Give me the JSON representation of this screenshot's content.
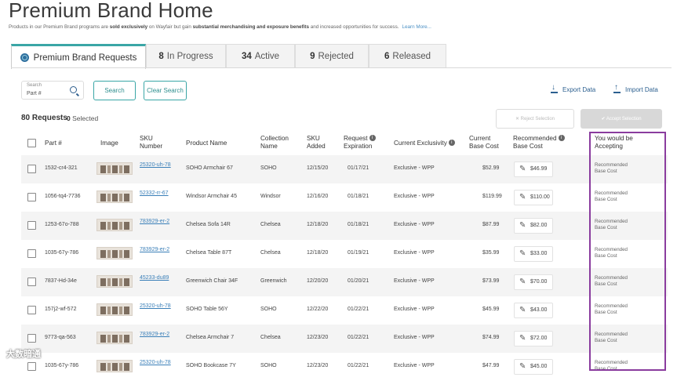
{
  "header": {
    "title": "Premium Brand Home",
    "subtitle_pre": "Products in our Premium Brand programs are ",
    "subtitle_b1": "sold exclusively",
    "subtitle_mid": " on Wayfair but gain ",
    "subtitle_b2": "substantial merchandising and exposure benefits",
    "subtitle_post": " and increased opportunities for success.",
    "learn_more": "Learn More..."
  },
  "tabs": [
    {
      "count": "",
      "label": "Premium Brand Requests"
    },
    {
      "count": "8",
      "label": "In Progress"
    },
    {
      "count": "34",
      "label": "Active"
    },
    {
      "count": "9",
      "label": "Rejected"
    },
    {
      "count": "6",
      "label": "Released"
    }
  ],
  "search": {
    "label": "Search",
    "placeholder": "Part #",
    "button": "Search",
    "clear": "Clear Search"
  },
  "actions": {
    "export": "Export Data",
    "import": "Import Data",
    "reject": "✕ Reject Selection",
    "accept": "✔ Accept Selection"
  },
  "summary": {
    "requests": "80 Requests",
    "selected_count": "0",
    "selected_label": "Selected"
  },
  "columns": {
    "part": "Part #",
    "image": "Image",
    "sku_1": "SKU",
    "sku_2": "Number",
    "product": "Product Name",
    "collection_1": "Collection",
    "collection_2": "Name",
    "added_1": "SKU",
    "added_2": "Added",
    "expiration_1": "Request",
    "expiration_2": "Expiration",
    "exclusivity": "Current Exclusivity",
    "base_1": "Current",
    "base_2": "Base Cost",
    "rec_1": "Recommended",
    "rec_2": "Base Cost",
    "accept_1": "You would be",
    "accept_2": "Accepting"
  },
  "rows": [
    {
      "part": "1532-cr4-321",
      "sku": "25320-uh-78",
      "product": "SOHO Armchair 67",
      "collection": "SOHO",
      "added": "12/15/20",
      "expiration": "01/17/21",
      "exclusivity": "Exclusive - WPP",
      "base": "$52.99",
      "rec": "$46.99",
      "accept_1": "Recommended",
      "accept_2": "Base Cost"
    },
    {
      "part": "1056-tq4-7736",
      "sku": "52332-rr-67",
      "product": "Windsor Armchair 45",
      "collection": "Windsor",
      "added": "12/16/20",
      "expiration": "01/18/21",
      "exclusivity": "Exclusive - WPP",
      "base": "$119.99",
      "rec": "$110.00",
      "accept_1": "Recommended",
      "accept_2": "Base Cost"
    },
    {
      "part": "1253-67o-788",
      "sku": "783929-er-2",
      "product": "Chelsea Sofa 14R",
      "collection": "Chelsea",
      "added": "12/18/20",
      "expiration": "01/18/21",
      "exclusivity": "Exclusive - WPP",
      "base": "$87.99",
      "rec": "$82.00",
      "accept_1": "Recommended",
      "accept_2": "Base Cost"
    },
    {
      "part": "1035-67y-786",
      "sku": "783929-er-2",
      "product": "Chelsea Table 87T",
      "collection": "Chelsea",
      "added": "12/18/20",
      "expiration": "01/19/21",
      "exclusivity": "Exclusive - WPP",
      "base": "$35.99",
      "rec": "$33.00",
      "accept_1": "Recommended",
      "accept_2": "Base Cost"
    },
    {
      "part": "7837-Hd-34e",
      "sku": "45233-du89",
      "product": "Greenwich Chair 34F",
      "collection": "Greenwich",
      "added": "12/20/20",
      "expiration": "01/20/21",
      "exclusivity": "Exclusive - WPP",
      "base": "$73.99",
      "rec": "$70.00",
      "accept_1": "Recommended",
      "accept_2": "Base Cost"
    },
    {
      "part": "157j2-wf-572",
      "sku": "25320-uh-78",
      "product": "SOHO Table 56Y",
      "collection": "SOHO",
      "added": "12/22/20",
      "expiration": "01/22/21",
      "exclusivity": "Exclusive - WPP",
      "base": "$45.99",
      "rec": "$43.00",
      "accept_1": "Recommended",
      "accept_2": "Base Cost"
    },
    {
      "part": "9773-qa-563",
      "sku": "783929-er-2",
      "product": "Chelsea Armchair 7",
      "collection": "Chelsea",
      "added": "12/23/20",
      "expiration": "01/22/21",
      "exclusivity": "Exclusive - WPP",
      "base": "$74.99",
      "rec": "$72.00",
      "accept_1": "Recommended",
      "accept_2": "Base Cost"
    },
    {
      "part": "1035-67y-786",
      "sku": "25320-uh-78",
      "product": "SOHO Bookcase 7Y",
      "collection": "SOHO",
      "added": "12/23/20",
      "expiration": "01/22/21",
      "exclusivity": "Exclusive - WPP",
      "base": "$47.99",
      "rec": "$45.00",
      "accept_1": "Recommended",
      "accept_2": "Base Cost"
    }
  ],
  "watermark": "大数暗通",
  "colors": {
    "accent": "#3aa6a6",
    "link": "#3a7fb8",
    "highlight": "#8a3c9e"
  }
}
